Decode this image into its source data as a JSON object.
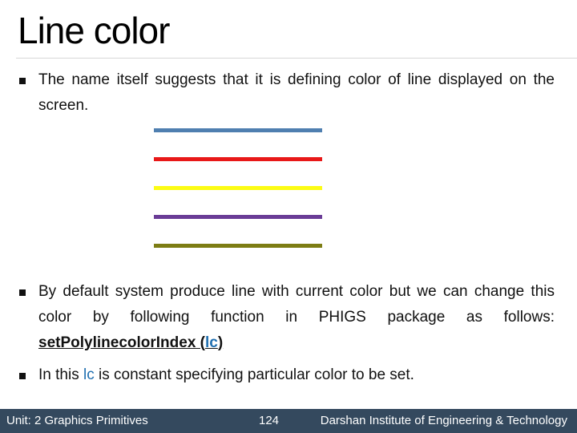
{
  "slide": {
    "title": "Line color",
    "bullets": [
      {
        "text": "The name itself suggests that it is defining color of line displayed on the screen."
      },
      {
        "text_before": "By default system produce line with current color but we can change this color by following function in PHIGS package as follows: ",
        "function_name": "setPolylinecolorIndex (",
        "function_arg": "lc",
        "function_close": ")"
      },
      {
        "text_before": "In this ",
        "highlight": "lc",
        "text_after": " is constant specifying particular color to be set."
      }
    ],
    "sample_lines": [
      {
        "name": "blue",
        "color": "#4f7fb0"
      },
      {
        "name": "red",
        "color": "#e81818"
      },
      {
        "name": "yellow",
        "color": "#fcfc14"
      },
      {
        "name": "purple",
        "color": "#6a3c96"
      },
      {
        "name": "olive",
        "color": "#7d7d14"
      }
    ]
  },
  "footer": {
    "unit": "Unit: 2 Graphics Primitives",
    "page_number": "124",
    "institute": "Darshan Institute of Engineering & Technology"
  }
}
